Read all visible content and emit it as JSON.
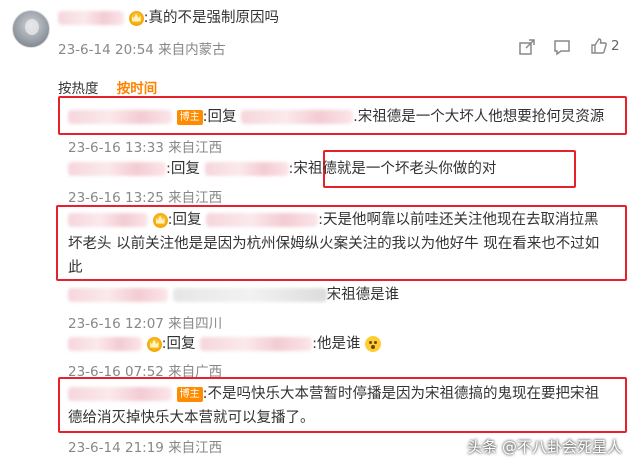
{
  "post": {
    "comment_text": ":真的不是强制原因吗",
    "time_location": "23-6-14 20:54 来自内蒙古",
    "like_count": "2"
  },
  "tabs": [
    {
      "label": "按热度"
    },
    {
      "label": "按时间"
    }
  ],
  "replies": [
    {
      "badge": "博主",
      "text": ":回复",
      "text2": ".宋祖德是一个大坏人他想要抢何炅资源",
      "meta": "23-6-16 13:33 来自江西"
    },
    {
      "text": ":回复",
      "text2": ":宋祖德就是一个坏老头你做的对",
      "meta": "23-6-16 13:25 来自江西"
    },
    {
      "text": ":回复",
      "text2": ":天是他啊靠以前哇还关注他现在去取消拉黑",
      "line2": "坏老头 以前关注他是是因为杭州保姆纵火案关注的我以为他好牛 现在看来也不过如",
      "line3": "此"
    },
    {
      "text2": "宋祖德是谁",
      "meta": "23-6-16 12:07 来自四川"
    },
    {
      "text": ":回复",
      "text2": ":他是谁",
      "meta": "23-6-16 07:52 来自广西"
    },
    {
      "badge": "博主",
      "text2": ":不是吗快乐大本营暂时停播是因为宋祖德搞的鬼现在要把宋祖",
      "line2": "德给消灭掉快乐大本营就可以复播了。",
      "meta": "23-6-14 21:19 来自江西"
    }
  ],
  "meta_extra": "23-6-16 13:25 来自江西",
  "watermark": "头条 @不八卦会死星人",
  "colors": {
    "accent": "#ff8200",
    "highlight_box": "#e6212b",
    "badge": "#ff8c00"
  },
  "icons": [
    "share-icon",
    "comment-icon",
    "like-icon",
    "crown-icon",
    "emoji-icon"
  ]
}
